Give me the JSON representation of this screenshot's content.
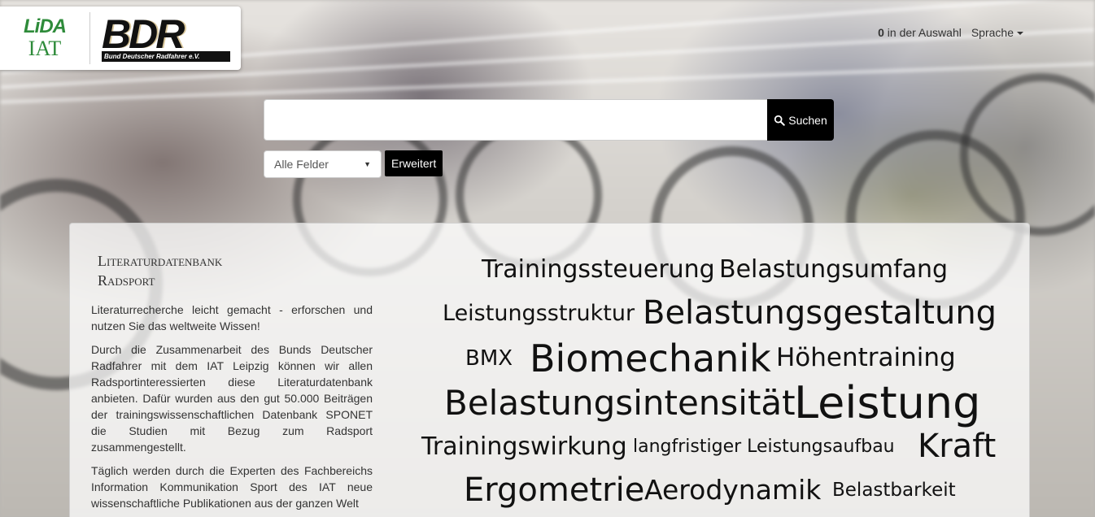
{
  "logos": {
    "lida_top": "LiDA",
    "lida_bottom": "IAT",
    "bdr": "BDR",
    "bdr_subtitle": "Bund Deutscher Radfahrer e.V."
  },
  "topnav": {
    "selection_count": "0",
    "selection_label": "in der Auswahl",
    "language_label": "Sprache"
  },
  "search": {
    "placeholder": "",
    "button_label": "Suchen",
    "field_select_value": "Alle Felder",
    "advanced_label": "Erweitert"
  },
  "intro": {
    "title_line1": "Literaturdatenbank",
    "title_line2": "Radsport",
    "p1": "Literaturrecherche leicht gemacht - erforschen und nutzen Sie das weltweite Wissen!",
    "p2": "Durch die Zusammenarbeit des Bunds Deutscher Radfahrer mit dem IAT Leipzig können wir allen Radsportinteressierten diese Literaturdatenbank anbieten. Dafür wurden aus den gut 50.000 Beiträgen der trainingswissenschaftlichen Datenbank SPONET die Studien mit Bezug zum Radsport zusammengestellt.",
    "p3": "Täglich werden durch die Experten des Fachbereichs Information Kommunikation Sport des IAT neue wissenschaftliche Publikationen aus der ganzen Welt"
  },
  "tags": [
    {
      "label": "Trainingssteuerung"
    },
    {
      "label": "Belastungsumfang"
    },
    {
      "label": "Leistungsstruktur"
    },
    {
      "label": "Belastungsgestaltung"
    },
    {
      "label": "BMX"
    },
    {
      "label": "Biomechanik"
    },
    {
      "label": "Höhentraining"
    },
    {
      "label": "Belastungsintensität"
    },
    {
      "label": "Leistung"
    },
    {
      "label": "Trainingswirkung"
    },
    {
      "label": "langfristiger Leistungsaufbau"
    },
    {
      "label": "Kraft"
    },
    {
      "label": "Ergometrie"
    },
    {
      "label": "Aerodynamik"
    },
    {
      "label": "Belastbarkeit"
    }
  ]
}
